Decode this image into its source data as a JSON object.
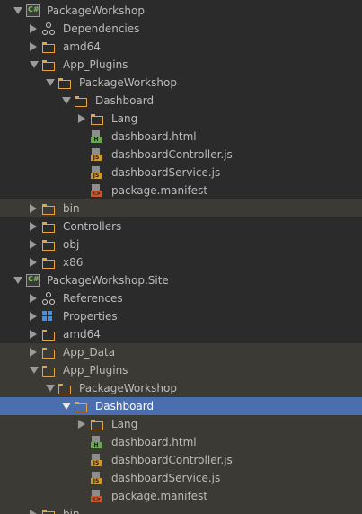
{
  "tree": {
    "rows": [
      {
        "label": "PackageWorkshop",
        "kind": "project",
        "depth": 0,
        "arrow": "expanded",
        "bg": ""
      },
      {
        "label": "Dependencies",
        "kind": "deps",
        "depth": 1,
        "arrow": "collapsed",
        "bg": ""
      },
      {
        "label": "amd64",
        "kind": "folder",
        "depth": 1,
        "arrow": "collapsed",
        "bg": ""
      },
      {
        "label": "App_Plugins",
        "kind": "folder",
        "depth": 1,
        "arrow": "expanded",
        "bg": ""
      },
      {
        "label": "PackageWorkshop",
        "kind": "folder",
        "depth": 2,
        "arrow": "expanded",
        "bg": ""
      },
      {
        "label": "Dashboard",
        "kind": "folder",
        "depth": 3,
        "arrow": "expanded",
        "bg": ""
      },
      {
        "label": "Lang",
        "kind": "folder",
        "depth": 4,
        "arrow": "collapsed",
        "bg": ""
      },
      {
        "label": "dashboard.html",
        "kind": "html",
        "depth": 4,
        "arrow": "none",
        "bg": ""
      },
      {
        "label": "dashboardController.js",
        "kind": "js",
        "depth": 4,
        "arrow": "none",
        "bg": ""
      },
      {
        "label": "dashboardService.js",
        "kind": "js",
        "depth": 4,
        "arrow": "none",
        "bg": ""
      },
      {
        "label": "package.manifest",
        "kind": "xml",
        "depth": 4,
        "arrow": "none",
        "bg": ""
      },
      {
        "label": "bin",
        "kind": "folder",
        "depth": 1,
        "arrow": "collapsed",
        "bg": "ignored"
      },
      {
        "label": "Controllers",
        "kind": "folder",
        "depth": 1,
        "arrow": "collapsed",
        "bg": ""
      },
      {
        "label": "obj",
        "kind": "folder",
        "depth": 1,
        "arrow": "collapsed",
        "bg": ""
      },
      {
        "label": "x86",
        "kind": "folder",
        "depth": 1,
        "arrow": "collapsed",
        "bg": ""
      },
      {
        "label": "PackageWorkshop.Site",
        "kind": "project",
        "depth": 0,
        "arrow": "expanded",
        "bg": ""
      },
      {
        "label": "References",
        "kind": "deps",
        "depth": 1,
        "arrow": "collapsed",
        "bg": ""
      },
      {
        "label": "Properties",
        "kind": "props",
        "depth": 1,
        "arrow": "collapsed",
        "bg": ""
      },
      {
        "label": "amd64",
        "kind": "folder",
        "depth": 1,
        "arrow": "collapsed",
        "bg": ""
      },
      {
        "label": "App_Data",
        "kind": "folder",
        "depth": 1,
        "arrow": "collapsed",
        "bg": "ignored"
      },
      {
        "label": "App_Plugins",
        "kind": "folder",
        "depth": 1,
        "arrow": "expanded",
        "bg": "ignored"
      },
      {
        "label": "PackageWorkshop",
        "kind": "folder",
        "depth": 2,
        "arrow": "expanded",
        "bg": "ignored"
      },
      {
        "label": "Dashboard",
        "kind": "folder",
        "depth": 3,
        "arrow": "expanded",
        "bg": "selected"
      },
      {
        "label": "Lang",
        "kind": "folder",
        "depth": 4,
        "arrow": "collapsed",
        "bg": "ignored"
      },
      {
        "label": "dashboard.html",
        "kind": "html",
        "depth": 4,
        "arrow": "none",
        "bg": "ignored"
      },
      {
        "label": "dashboardController.js",
        "kind": "js",
        "depth": 4,
        "arrow": "none",
        "bg": "ignored"
      },
      {
        "label": "dashboardService.js",
        "kind": "js",
        "depth": 4,
        "arrow": "none",
        "bg": "ignored"
      },
      {
        "label": "package.manifest",
        "kind": "xml",
        "depth": 4,
        "arrow": "none",
        "bg": "ignored"
      },
      {
        "label": "bin",
        "kind": "folder",
        "depth": 1,
        "arrow": "collapsed",
        "bg": "ignored"
      }
    ],
    "badges": {
      "project": "C#",
      "html": "H",
      "js": "JS",
      "xml": "<>"
    }
  }
}
